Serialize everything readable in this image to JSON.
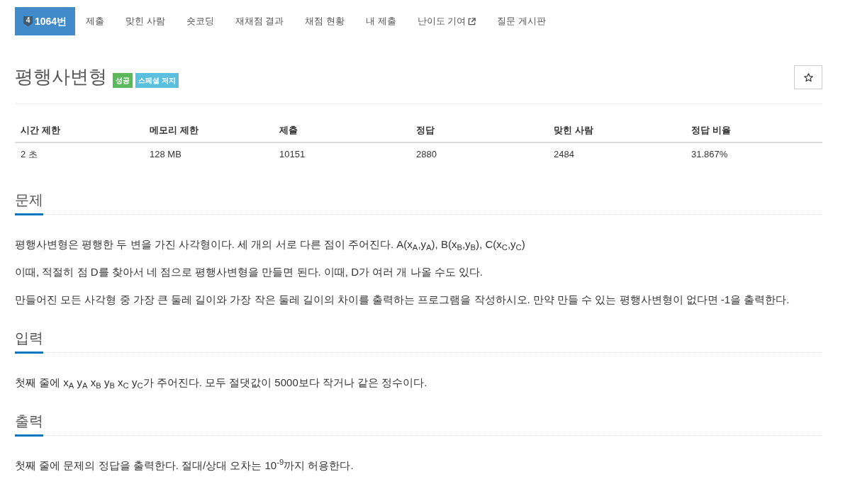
{
  "nav": {
    "tabs": [
      {
        "label": "1064번",
        "selected": true,
        "tier": "4",
        "external": false
      },
      {
        "label": "제출",
        "selected": false,
        "external": false
      },
      {
        "label": "맞힌 사람",
        "selected": false,
        "external": false
      },
      {
        "label": "숏코딩",
        "selected": false,
        "external": false
      },
      {
        "label": "재채점 결과",
        "selected": false,
        "external": false
      },
      {
        "label": "채점 현황",
        "selected": false,
        "external": false
      },
      {
        "label": "내 제출",
        "selected": false,
        "external": false
      },
      {
        "label": "난이도 기여",
        "selected": false,
        "external": true
      },
      {
        "label": "질문 게시판",
        "selected": false,
        "external": false
      }
    ]
  },
  "problem": {
    "title": "평행사변형",
    "labels": [
      {
        "text": "성공",
        "color": "#5cb85c"
      },
      {
        "text": "스페셜 저지",
        "color": "#5bc0de"
      }
    ],
    "starred": false
  },
  "info_table": {
    "columns": [
      "시간 제한",
      "메모리 제한",
      "제출",
      "정답",
      "맞힌 사람",
      "정답 비율"
    ],
    "rows": [
      [
        "2 초",
        "128 MB",
        "10151",
        "2880",
        "2484",
        "31.867%"
      ]
    ]
  },
  "sections": [
    {
      "title": "문제",
      "paragraphs": [
        "평행사변형은 평행한 두 변을 가진 사각형이다. 세 개의 서로 다른 점이 주어진다. A(x$_{A}$,y$_{A}$), B(x$_{B}$,y$_{B}$), C(x$_{C}$,y$_{C}$)",
        "이때, 적절히 점 D를 찾아서 네 점으로 평행사변형을 만들면 된다. 이때, D가 여러 개 나올 수도 있다.",
        "만들어진 모든 사각형 중 가장 큰 둘레 길이와 가장 작은 둘레 길이의 차이를 출력하는 프로그램을 작성하시오. 만약 만들 수 있는 평행사변형이 없다면 -1을 출력한다."
      ]
    },
    {
      "title": "입력",
      "paragraphs": [
        "첫째 줄에 x$_{A}$ y$_{A}$ x$_{B}$ y$_{B}$ x$_{C}$ y$_{C}$가 주어진다. 모두 절댓값이 5000보다 작거나 같은 정수이다."
      ]
    },
    {
      "title": "출력",
      "paragraphs": [
        "첫째 줄에 문제의 정답을 출력한다. 절대/상대 오차는 10$^{-9}$까지 허용한다."
      ]
    }
  ]
}
